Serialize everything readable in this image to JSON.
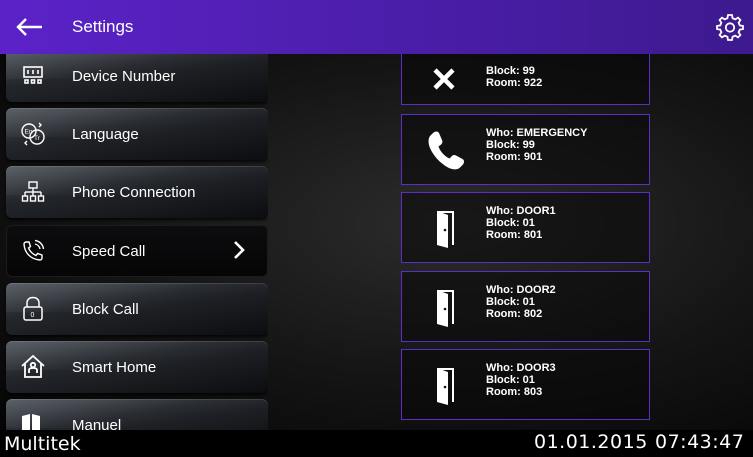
{
  "header": {
    "title": "Settings",
    "back_icon": "arrow-left-icon",
    "settings_icon": "gear-icon"
  },
  "menu": {
    "items": [
      {
        "label": "Device Number",
        "icon": "device-number-icon"
      },
      {
        "label": "Language",
        "icon": "language-icon"
      },
      {
        "label": "Phone Connection",
        "icon": "network-icon"
      },
      {
        "label": "Speed Call",
        "icon": "speed-call-icon",
        "active": true
      },
      {
        "label": "Block Call",
        "icon": "lock-icon"
      },
      {
        "label": "Smart Home",
        "icon": "smart-home-icon"
      },
      {
        "label": "Manuel",
        "icon": "manual-icon"
      }
    ]
  },
  "speed_calls": [
    {
      "who": "",
      "block": "Block: 99",
      "room": "Room: 922",
      "icon": "tools-icon"
    },
    {
      "who": "Who: EMERGENCY",
      "block": "Block: 99",
      "room": "Room: 901",
      "icon": "phone-icon"
    },
    {
      "who": "Who: DOOR1",
      "block": "Block: 01",
      "room": "Room: 801",
      "icon": "door-icon"
    },
    {
      "who": "Who: DOOR2",
      "block": "Block: 01",
      "room": "Room: 802",
      "icon": "door-icon"
    },
    {
      "who": "Who: DOOR3",
      "block": "Block: 01",
      "room": "Room: 803",
      "icon": "door-icon"
    }
  ],
  "footer": {
    "brand": "Multitek",
    "date": "01.01.2015",
    "time": "07:43:47"
  },
  "colors": {
    "header": "#5b22c8",
    "card_border": "#5a2fc2"
  }
}
